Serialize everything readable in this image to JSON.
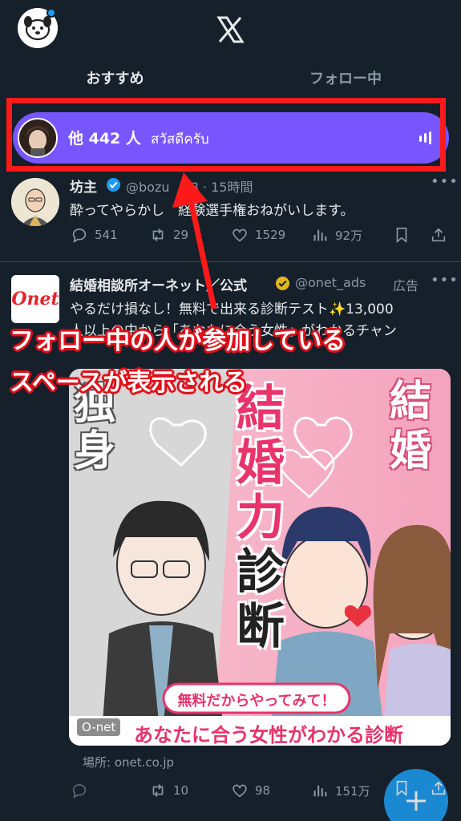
{
  "header": {
    "logo": "X",
    "tabs": [
      {
        "label": "おすすめ",
        "active": true
      },
      {
        "label": "フォロー中",
        "active": false
      }
    ]
  },
  "spaces": {
    "count_label": "他 442 人",
    "title": "สวัสดีครับ",
    "color": "#7856ff"
  },
  "tweets": [
    {
      "name": "坊主",
      "handle": "@bozu",
      "handle_suffix": "08",
      "time": "15時間",
      "text_a": "酔ってやらかし",
      "text_b": "経験選手権おねがいします。",
      "replies": "541",
      "retweets": "29",
      "likes": "1529",
      "views": "92万"
    },
    {
      "name": "結婚相談所オーネット／公式",
      "handle": "@onet_ads",
      "ad_label": "広告",
      "avatar_logo": "Onet",
      "line1": "やるだけ損なし！無料で出来る診断テスト✨13,000",
      "line2": "人以上の中から「あなたに合う女性」がわかるチャン",
      "image": {
        "left_text_1": "独",
        "left_text_2": "身",
        "right_text_1": "結",
        "right_text_2": "婚",
        "center_text": [
          "結",
          "婚",
          "力",
          "診",
          "断"
        ],
        "banner_top": "無料だからやってみて！",
        "banner_bottom": "あなたに合う女性がわかる診断",
        "watermark": "O-net"
      },
      "location": "場所: onet.co.jp",
      "retweets": "10",
      "likes": "98",
      "views": "151万"
    }
  ],
  "annotation": {
    "line1": "フォロー中の人が参加している",
    "line2": "スペースが表示される"
  },
  "colors": {
    "background": "#15202b",
    "accent": "#1d9bf0",
    "annotation_red": "#ff1a1a"
  }
}
